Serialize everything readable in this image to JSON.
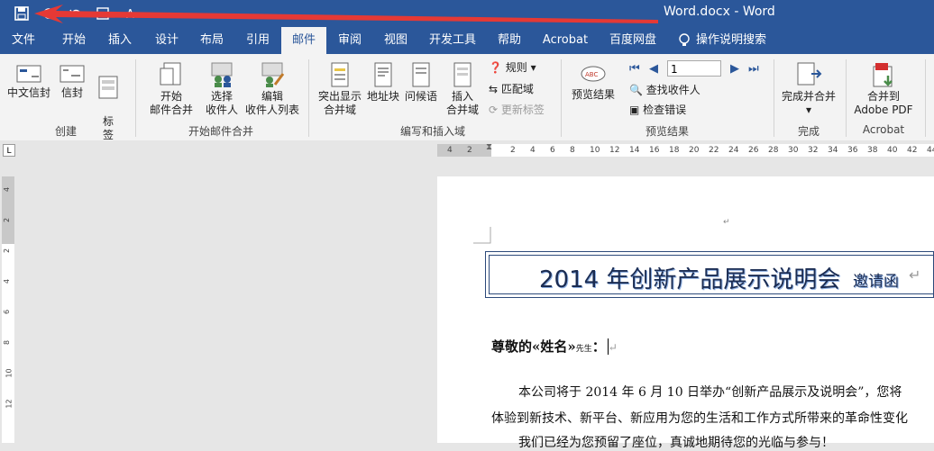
{
  "window": {
    "title": "Word.docx - Word"
  },
  "tabs": [
    {
      "label": "文件"
    },
    {
      "label": "开始"
    },
    {
      "label": "插入"
    },
    {
      "label": "设计"
    },
    {
      "label": "布局"
    },
    {
      "label": "引用"
    },
    {
      "label": "邮件"
    },
    {
      "label": "审阅"
    },
    {
      "label": "视图"
    },
    {
      "label": "开发工具"
    },
    {
      "label": "帮助"
    },
    {
      "label": "Acrobat"
    },
    {
      "label": "百度网盘"
    },
    {
      "label": "操作说明搜索"
    }
  ],
  "active_tab": "邮件",
  "ribbon": {
    "create": {
      "group": "创建",
      "envelopes_cn": "中文信封",
      "envelopes": "信封",
      "labels": "标\n签"
    },
    "start": {
      "group": "开始邮件合并",
      "start_merge_1": "开始",
      "start_merge_2": "邮件合并",
      "select_1": "选择",
      "select_2": "收件人",
      "edit_1": "编辑",
      "edit_2": "收件人列表"
    },
    "write": {
      "group": "编写和插入域",
      "highlight_1": "突出显示",
      "highlight_2": "合并域",
      "address": "地址块",
      "greeting": "问候语",
      "insert_1": "插入",
      "insert_2": "合并域",
      "rules": "规则",
      "match": "匹配域",
      "update": "更新标签"
    },
    "preview": {
      "group": "预览结果",
      "preview": "预览结果",
      "record": "1",
      "find": "查找收件人",
      "check": "检查错误"
    },
    "finish": {
      "group": "完成",
      "finish": "完成并合并"
    },
    "acrobat": {
      "group": "Acrobat",
      "merge_1": "合并到",
      "merge_2": "Adobe PDF"
    }
  },
  "ruler_ticks": [
    "4",
    "2",
    "2",
    "4",
    "6",
    "8",
    "10",
    "12",
    "14",
    "16",
    "18",
    "20",
    "22",
    "24",
    "26",
    "28",
    "30",
    "32",
    "34",
    "36",
    "38",
    "40",
    "42",
    "44"
  ],
  "vruler_ticks": [
    "4",
    "2",
    "2",
    "4",
    "6",
    "8",
    "10",
    "12"
  ],
  "document": {
    "title": "2014 年创新产品展示说明会",
    "subtitle": "邀请函",
    "salutation_bold": "尊敬的«姓名»",
    "salutation_small": "先生",
    "salutation_colon": "：",
    "para1": "本公司将于 2014 年 6 月 10 日举办“创新产品展示及说明会”，您将",
    "para2": "体验到新技术、新平台、新应用为您的生活和工作方式所带来的革命性变化",
    "para3": "我们已经为您预留了座位，真诚地期待您的光临与参与！"
  },
  "colors": {
    "accent": "#2b579a",
    "arrow": "#e53935"
  }
}
